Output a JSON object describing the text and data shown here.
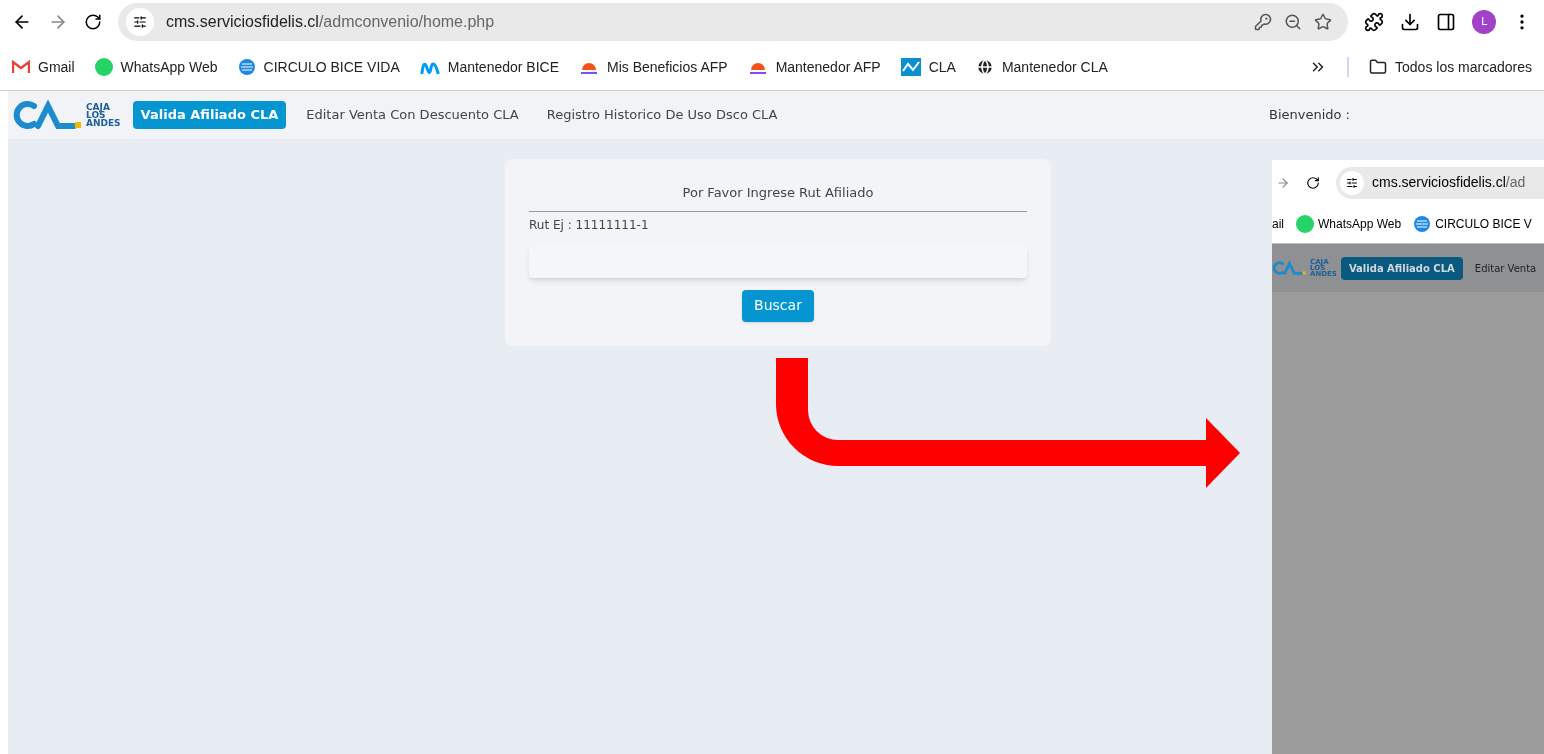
{
  "browser": {
    "url_host": "cms.serviciosfidelis.cl",
    "url_path": "/admconvenio/home.php",
    "profile_initial": "L",
    "bookmarks": [
      {
        "label": "Gmail",
        "kind": "gmail"
      },
      {
        "label": "WhatsApp Web",
        "kind": "whatsapp"
      },
      {
        "label": "CIRCULO BICE VIDA",
        "kind": "bice"
      },
      {
        "label": "Mantenedor BICE",
        "kind": "movistar"
      },
      {
        "label": "Mis Beneficios AFP",
        "kind": "afp"
      },
      {
        "label": "Mantenedor AFP",
        "kind": "afp"
      },
      {
        "label": "CLA",
        "kind": "cla"
      },
      {
        "label": "Mantenedor CLA",
        "kind": "globe"
      }
    ],
    "all_bookmarks": "Todos los marcadores"
  },
  "site": {
    "logo_lines": [
      "CAJA",
      "LOS",
      "ANDES"
    ],
    "nav": [
      {
        "label": "Valida Afiliado CLA",
        "selected": true
      },
      {
        "label": "Editar Venta Con Descuento CLA",
        "selected": false
      },
      {
        "label": "Registro Historico De Uso Dsco CLA",
        "selected": false
      }
    ],
    "welcome": "Bienvenido :"
  },
  "form": {
    "title": "Por Favor Ingrese Rut Afiliado",
    "label": "Rut Ej : 11111111-1",
    "button": "Buscar"
  },
  "inset": {
    "url_host": "cms.serviciosfidelis.cl",
    "url_path": "/ad",
    "bookmarks": [
      {
        "label": "ail",
        "kind": "none"
      },
      {
        "label": "WhatsApp Web",
        "kind": "whatsapp"
      },
      {
        "label": "CIRCULO BICE V",
        "kind": "bice"
      }
    ],
    "logo_lines": [
      "CAJA",
      "LOS",
      "ANDES"
    ],
    "nav": [
      {
        "label": "Valida Afiliado CLA",
        "selected": true
      },
      {
        "label": "Editar Venta",
        "selected": false
      }
    ]
  }
}
